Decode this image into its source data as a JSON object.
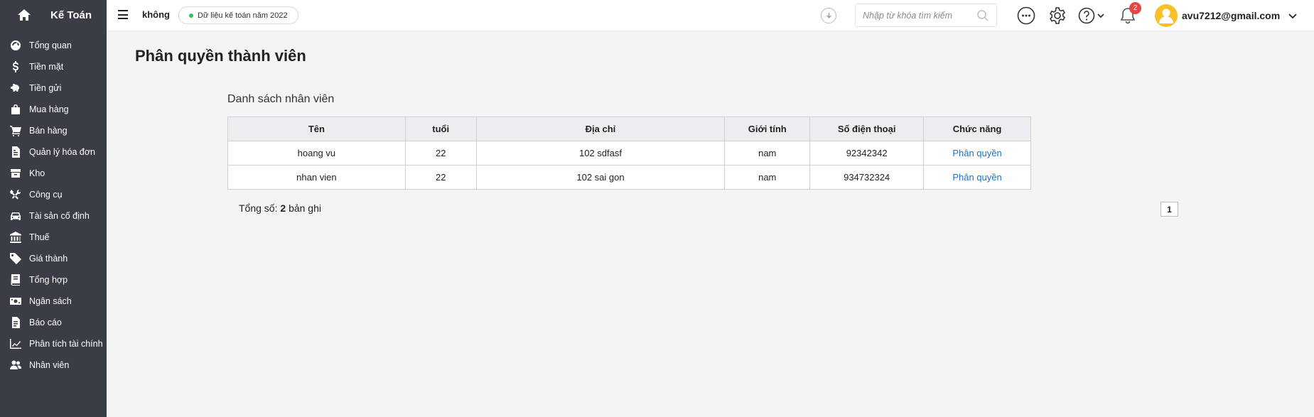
{
  "sidebar": {
    "brand": "Kế Toán",
    "items": [
      {
        "label": "Tổng quan",
        "icon": "dashboard-icon"
      },
      {
        "label": "Tiền mặt",
        "icon": "dollar-icon"
      },
      {
        "label": "Tiền gửi",
        "icon": "piggy-bank-icon"
      },
      {
        "label": "Mua hàng",
        "icon": "shopping-bag-icon"
      },
      {
        "label": "Bán hàng",
        "icon": "cart-icon"
      },
      {
        "label": "Quản lý hóa đơn",
        "icon": "invoice-icon"
      },
      {
        "label": "Kho",
        "icon": "warehouse-icon"
      },
      {
        "label": "Công cụ",
        "icon": "tools-icon"
      },
      {
        "label": "Tài sản cố định",
        "icon": "car-icon"
      },
      {
        "label": "Thuế",
        "icon": "bank-icon"
      },
      {
        "label": "Giá thành",
        "icon": "tag-icon"
      },
      {
        "label": "Tổng hợp",
        "icon": "book-icon"
      },
      {
        "label": "Ngân sách",
        "icon": "money-icon"
      },
      {
        "label": "Báo cáo",
        "icon": "report-icon"
      },
      {
        "label": "Phân tích tài chính",
        "icon": "line-chart-icon"
      },
      {
        "label": "Nhân viên",
        "icon": "users-icon"
      }
    ]
  },
  "topbar": {
    "company": "không",
    "database": "Dữ liệu kế toán năm 2022",
    "search_placeholder": "Nhập từ khóa tìm kiếm",
    "notification_count": "2",
    "user_email": "avu7212@gmail.com"
  },
  "main": {
    "page_title": "Phân quyền thành viên",
    "section_title": "Danh sách nhân viên",
    "table": {
      "headers": [
        "Tên",
        "tuổi",
        "Địa chỉ",
        "Giới tính",
        "Số điện thoại",
        "Chức năng"
      ],
      "rows": [
        [
          "hoang vu",
          "22",
          "102 sdfasf",
          "nam",
          "92342342",
          "Phân quyền"
        ],
        [
          "nhan vien",
          "22",
          "102 sai gon",
          "nam",
          "934732324",
          "Phân quyền"
        ]
      ]
    },
    "total_label": "Tổng số:",
    "total_count": "2",
    "total_suffix": "bản ghi",
    "current_page": "1"
  }
}
